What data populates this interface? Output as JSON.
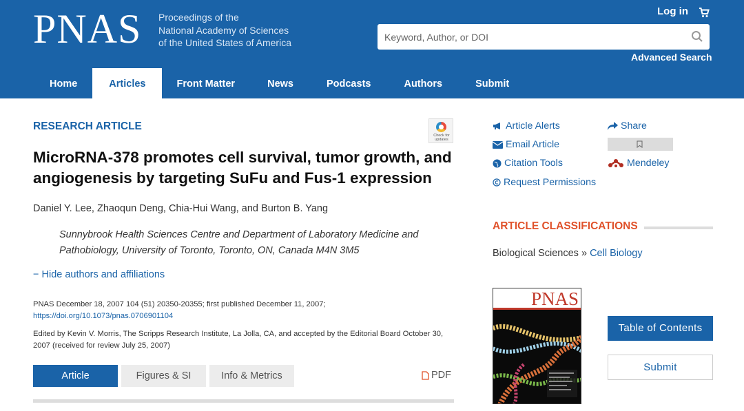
{
  "header": {
    "logo": "PNAS",
    "tagline": [
      "Proceedings of the",
      "National Academy of Sciences",
      "of the United States of America"
    ],
    "login_label": "Log in",
    "search_placeholder": "Keyword, Author, or DOI",
    "advanced_search_label": "Advanced Search",
    "brand_color": "#1a63a8"
  },
  "nav": {
    "items": [
      {
        "label": "Home"
      },
      {
        "label": "Articles",
        "active": true
      },
      {
        "label": "Front Matter"
      },
      {
        "label": "News"
      },
      {
        "label": "Podcasts"
      },
      {
        "label": "Authors"
      },
      {
        "label": "Submit"
      }
    ]
  },
  "article": {
    "type": "RESEARCH ARTICLE",
    "check_updates": "Check for updates",
    "title": "MicroRNA-378 promotes cell survival, tumor growth, and angiogenesis by targeting SuFu and Fus-1 expression",
    "authors": "Daniel Y. Lee, Zhaoqun Deng, Chia-Hui Wang, and Burton B. Yang",
    "affiliation": "Sunnybrook Health Sciences Centre and Department of Laboratory Medicine and Pathobiology, University of Toronto, Toronto, ON, Canada M4N 3M5",
    "hide_authors_label": "− Hide authors and affiliations",
    "pub_info": "PNAS December 18, 2007 104 (51) 20350-20355; first published December 11, 2007;",
    "doi": "https://doi.org/10.1073/pnas.0706901104",
    "edited_by": "Edited by Kevin V. Morris, The Scripps Research Institute, La Jolla, CA, and accepted by the Editorial Board October 30, 2007 (received for review July 25, 2007)"
  },
  "tabs": [
    {
      "label": "Article",
      "active": true
    },
    {
      "label": "Figures & SI"
    },
    {
      "label": "Info & Metrics"
    }
  ],
  "pdf_label": "PDF",
  "sidebar": {
    "tools": {
      "article_alerts": "Article Alerts",
      "email_article": "Email Article",
      "citation_tools": "Citation Tools",
      "request_permissions": "Request Permissions",
      "share": "Share",
      "mendeley": "Mendeley"
    },
    "classifications_heading": "ARTICLE CLASSIFICATIONS",
    "classification_area": "Biological Sciences",
    "classification_separator": " » ",
    "classification_link": "Cell Biology",
    "cover_logo": "PNAS",
    "toc_label": "Table of Contents",
    "submit_label": "Submit",
    "accent_color": "#e0522b"
  }
}
